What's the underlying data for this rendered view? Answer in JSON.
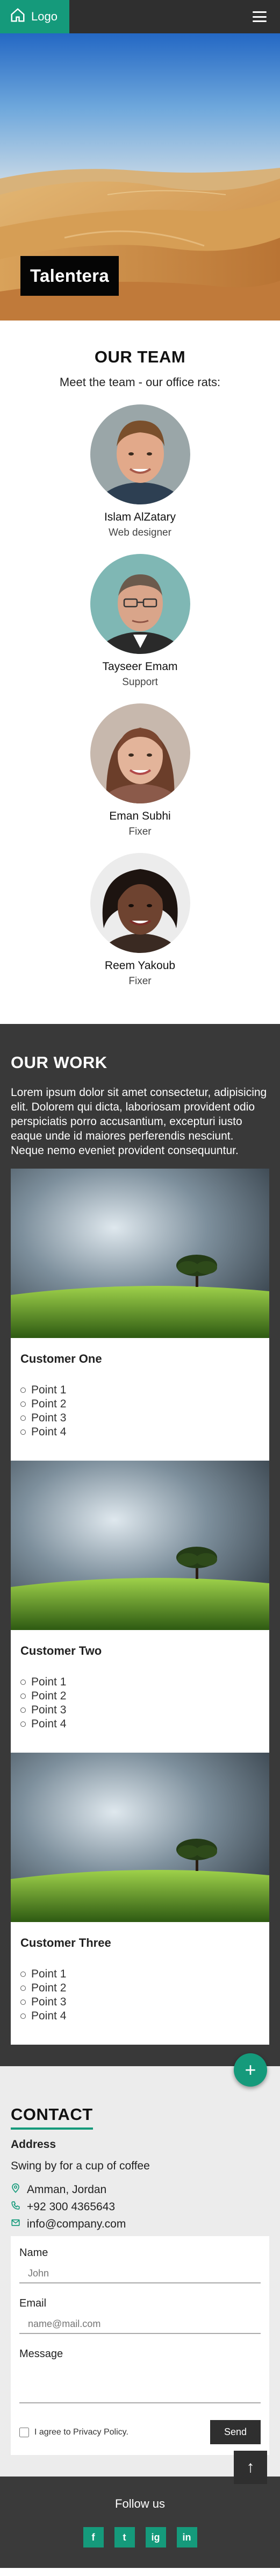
{
  "nav": {
    "logo_label": "Logo",
    "menu_icon": "hamburger-icon"
  },
  "hero": {
    "title": "Talentera"
  },
  "team": {
    "title": "OUR TEAM",
    "subtitle": "Meet the team - our office rats:",
    "members": [
      {
        "name": "Islam AlZatary",
        "role": "Web designer"
      },
      {
        "name": "Tayseer Emam",
        "role": "Support"
      },
      {
        "name": "Eman Subhi",
        "role": "Fixer"
      },
      {
        "name": "Reem Yakoub",
        "role": "Fixer"
      }
    ]
  },
  "work": {
    "title": "OUR WORK",
    "lead": "Lorem ipsum dolor sit amet consectetur, adipisicing elit. Dolorem qui dicta, laboriosam provident odio perspiciatis porro accusantium, excepturi iusto eaque unde id maiores perferendis nesciunt. Neque nemo eveniet provident consequuntur.",
    "cards": [
      {
        "title": "Customer One",
        "points": [
          "Point 1",
          "Point 2",
          "Point 3",
          "Point 4"
        ]
      },
      {
        "title": "Customer Two",
        "points": [
          "Point 1",
          "Point 2",
          "Point 3",
          "Point 4"
        ]
      },
      {
        "title": "Customer Three",
        "points": [
          "Point 1",
          "Point 2",
          "Point 3",
          "Point 4"
        ]
      }
    ],
    "fab_label": "+"
  },
  "contact": {
    "title": "CONTACT",
    "address_heading": "Address",
    "address_sub": "Swing by for a cup of coffee",
    "location": "Amman, Jordan",
    "phone": "+92 300 4365643",
    "email": "info@company.com",
    "form": {
      "name_label": "Name",
      "name_placeholder": "John",
      "email_label": "Email",
      "email_placeholder": "name@mail.com",
      "message_label": "Message",
      "agree_label": "I agree to Privacy Policy.",
      "send_label": "Send"
    },
    "top_button": "↑"
  },
  "footer": {
    "follow": "Follow us",
    "socials": [
      "f",
      "t",
      "ig",
      "in"
    ]
  },
  "colors": {
    "accent": "#159a7b",
    "dark": "#2f2f2f",
    "work_bg": "#393939",
    "contact_bg": "#ececec"
  }
}
